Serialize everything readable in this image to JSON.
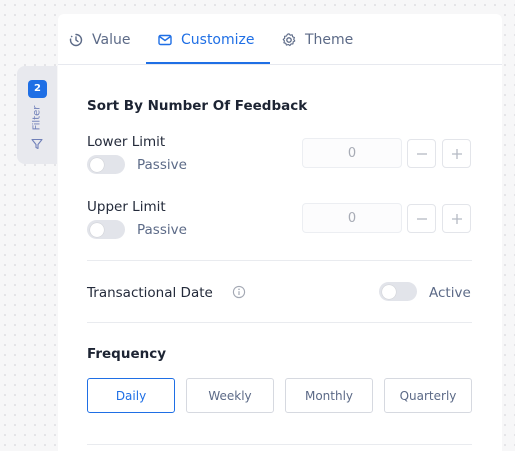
{
  "filter": {
    "badge": "2",
    "label": "Filter",
    "icon": "funnel-icon"
  },
  "tabs": [
    {
      "label": "Value",
      "icon": "clock-rotate-icon",
      "active": false
    },
    {
      "label": "Customize",
      "icon": "envelope-icon",
      "active": true
    },
    {
      "label": "Theme",
      "icon": "gear-icon",
      "active": false
    }
  ],
  "sort_section": {
    "title": "Sort By Number Of Feedback",
    "lower": {
      "label": "Lower Limit",
      "toggle_text": "Passive",
      "value": "0"
    },
    "upper": {
      "label": "Upper Limit",
      "toggle_text": "Passive",
      "value": "0"
    }
  },
  "transactional": {
    "label": "Transactional Date",
    "toggle_text": "Active",
    "icon": "info-icon"
  },
  "frequency": {
    "title": "Frequency",
    "options": [
      "Daily",
      "Weekly",
      "Monthly",
      "Quarterly"
    ],
    "selected": "Daily"
  },
  "colors": {
    "accent": "#1f6fe5",
    "muted_text": "#5c6a87"
  }
}
